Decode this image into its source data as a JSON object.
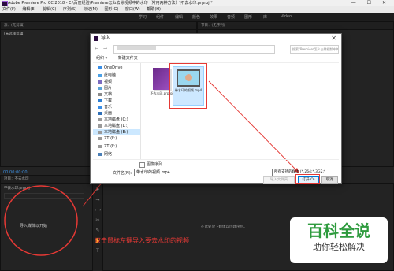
{
  "app": {
    "title": "Adobe Premiere Pro CC 2018 - E:\\百度经验\\Premiere怎么去除视频中的水印（常用两种方法）\\不去水印.prproj *",
    "window_buttons": "— ☐ ✕"
  },
  "menu": [
    "文件(F)",
    "编辑(E)",
    "剪辑(C)",
    "序列(S)",
    "标记(M)",
    "图形(G)",
    "窗口(W)",
    "帮助(H)"
  ],
  "workspaces": [
    "学习",
    "组件",
    "编辑",
    "颜色",
    "效果",
    "音频",
    "图形",
    "库",
    "Video"
  ],
  "left_top_panel": {
    "tab": "源：(无剪辑)",
    "status": "(未选择剪辑)"
  },
  "right_top_panel": {
    "tab": "节目：(无序列)"
  },
  "project_panel": {
    "tab": "项目：不去水印",
    "file": "不去水印.prproj",
    "hint": "导入媒体以开始"
  },
  "timeline_panel": {
    "hint": "在此处放下媒体以创建序列。"
  },
  "timecode": "00:00:00:00",
  "dialog": {
    "title": "导入",
    "close": "✕",
    "nav_buttons": "← → ↑",
    "path": "",
    "search_placeholder": "搜索\"Premiere怎么去除视频中的水印\"",
    "toolbar": {
      "organize": "组织 ▾",
      "new_folder": "新建文件夹"
    },
    "nav": [
      {
        "label": "OneDrive",
        "icon": "cloud-icon"
      },
      {
        "label": "此电脑",
        "icon": "computer-icon"
      },
      {
        "label": "视频",
        "icon": "video-folder-icon"
      },
      {
        "label": "图片",
        "icon": "picture-folder-icon"
      },
      {
        "label": "文档",
        "icon": "document-folder-icon"
      },
      {
        "label": "下载",
        "icon": "download-folder-icon"
      },
      {
        "label": "音乐",
        "icon": "music-folder-icon"
      },
      {
        "label": "桌面",
        "icon": "desktop-folder-icon"
      },
      {
        "label": "本地磁盘 (C:)",
        "icon": "drive-icon"
      },
      {
        "label": "本地磁盘 (D:)",
        "icon": "drive-icon"
      },
      {
        "label": "本地磁盘 (E:)",
        "icon": "drive-icon"
      },
      {
        "label": "ZT (F:)",
        "icon": "drive-icon"
      },
      {
        "label": "ZT (F:)",
        "icon": "drive-icon"
      },
      {
        "label": "网络",
        "icon": "network-icon"
      }
    ],
    "files": [
      {
        "name": "不去水印.prproj",
        "type": "prproj"
      },
      {
        "name": "带水印的视频.mp4",
        "type": "video"
      }
    ],
    "image_sequence_label": "图像序列",
    "filename_label": "文件名(N):",
    "filename_value": "带水印的视频.mp4",
    "filetype_value": "所有支持的媒体 (*.264;*.3G2;*",
    "import_folder_button": "导入文件夹",
    "open_button": "打开(O)",
    "cancel_button": "取消"
  },
  "annotation": "双击鼠标左键导入要去水印的视频",
  "watermark": {
    "line1": "百科全说",
    "line2": "助你轻松解决"
  },
  "colors": {
    "accent_red": "#e53935",
    "watermark_green": "#2e9b3e"
  }
}
